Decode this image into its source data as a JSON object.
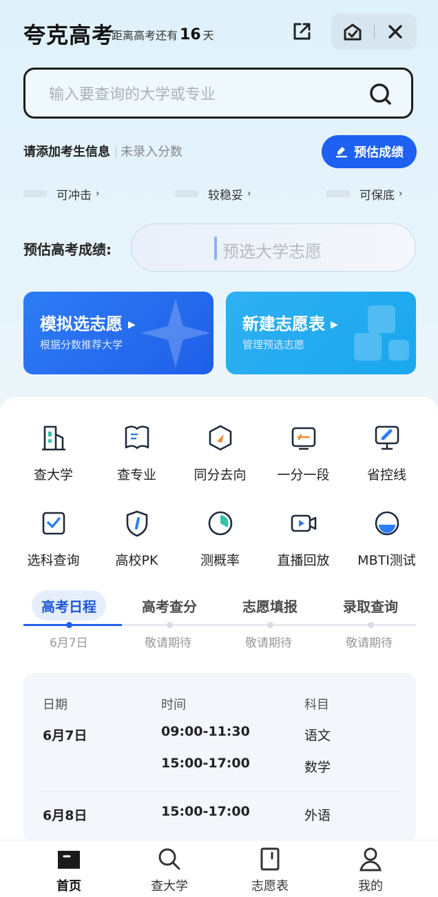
{
  "header": {
    "title": "夸克高考",
    "countdown_prefix": "距离高考还有",
    "countdown_days": "16",
    "countdown_suffix": "天"
  },
  "search": {
    "placeholder": "输入要查询的大学或专业"
  },
  "student": {
    "info_label": "请添加考生信息",
    "score_status": "未录入分数",
    "estimate_button": "预估成绩"
  },
  "levels": [
    {
      "label": "可冲击"
    },
    {
      "label": "较稳妥"
    },
    {
      "label": "可保底"
    }
  ],
  "estimate": {
    "label": "预估高考成绩:",
    "pill_text": "预选大学志愿"
  },
  "cards": {
    "simulate": {
      "title": "模拟选志愿",
      "subtitle": "根据分数推荐大学"
    },
    "newtable": {
      "title": "新建志愿表",
      "subtitle": "管理预选志愿"
    }
  },
  "tools_row1": [
    {
      "label": "查大学",
      "icon": "building-icon"
    },
    {
      "label": "查专业",
      "icon": "book-icon"
    },
    {
      "label": "同分去向",
      "icon": "compass-icon"
    },
    {
      "label": "一分一段",
      "icon": "score-segment-icon"
    },
    {
      "label": "省控线",
      "icon": "monitor-icon"
    }
  ],
  "tools_row2": [
    {
      "label": "选科查询",
      "icon": "checkbox-icon"
    },
    {
      "label": "高校PK",
      "icon": "shield-icon"
    },
    {
      "label": "测概率",
      "icon": "pie-icon"
    },
    {
      "label": "直播回放",
      "icon": "video-icon"
    },
    {
      "label": "MBTI测试",
      "icon": "bowl-icon"
    }
  ],
  "schedule_tabs": [
    {
      "label": "高考日程",
      "date": "6月7日",
      "active": true
    },
    {
      "label": "高考查分",
      "date": "敬请期待",
      "active": false
    },
    {
      "label": "志愿填报",
      "date": "敬请期待",
      "active": false
    },
    {
      "label": "录取查询",
      "date": "敬请期待",
      "active": false
    }
  ],
  "schedule": {
    "headers": {
      "date": "日期",
      "time": "时间",
      "subject": "科目"
    },
    "rows": [
      {
        "date": "6月7日",
        "time": "09:00-11:30",
        "subject": "语文"
      },
      {
        "date": "",
        "time": "15:00-17:00",
        "subject": "数学"
      },
      {
        "date": "6月8日",
        "time": "15:00-17:00",
        "subject": "外语"
      }
    ]
  },
  "bottom_nav": [
    {
      "label": "首页",
      "icon": "home-icon",
      "active": true
    },
    {
      "label": "查大学",
      "icon": "search-icon",
      "active": false
    },
    {
      "label": "志愿表",
      "icon": "document-icon",
      "active": false
    },
    {
      "label": "我的",
      "icon": "user-icon",
      "active": false
    }
  ],
  "colors": {
    "accent": "#1e60f2",
    "card_blue": "#2e7cf6",
    "card_cyan": "#19a7ee"
  }
}
